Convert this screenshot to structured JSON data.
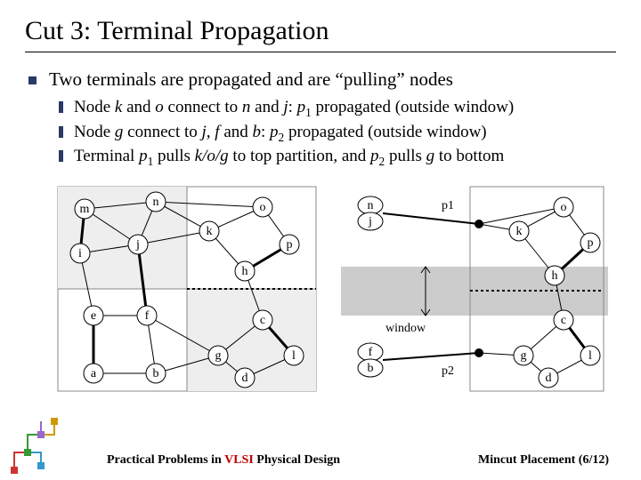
{
  "title": "Cut 3: Terminal Propagation",
  "main_bullet": "Two terminals are propagated and are “pulling” nodes",
  "sub_bullets": [
    {
      "html": "Node <em class='var'>k</em> and <em class='var'>o</em> connect to <em class='var'>n</em> and <em class='var'>j</em>: <em class='var'>p</em><sub>1</sub> propagated (outside window)"
    },
    {
      "html": "Node <em class='var'>g</em> connect to <em class='var'>j, f</em> and <em class='var'>b</em>: <em class='var'>p</em><sub>2</sub> propagated (outside window)"
    },
    {
      "html": "Terminal <em class='var'>p</em><sub>1</sub> pulls <em class='var'>k/o/g</em> to top partition, and <em class='var'>p</em><sub>2</sub> pulls <em class='var'>g</em> to bottom"
    }
  ],
  "fig1": {
    "nodes": [
      "m",
      "n",
      "o",
      "i",
      "j",
      "k",
      "p",
      "h",
      "e",
      "f",
      "c",
      "a",
      "b",
      "g",
      "d",
      "l"
    ]
  },
  "fig2": {
    "left_labels": [
      "n",
      "j",
      "f",
      "b"
    ],
    "window_label": "window",
    "p1": "p1",
    "p2": "p2",
    "nodes": [
      "o",
      "k",
      "p",
      "h",
      "c",
      "g",
      "d",
      "l"
    ]
  },
  "footer_left_a": "Practical Problems in ",
  "footer_left_b": "VLSI",
  "footer_left_c": " Physical Design",
  "footer_right": "Mincut Placement (6/12)"
}
